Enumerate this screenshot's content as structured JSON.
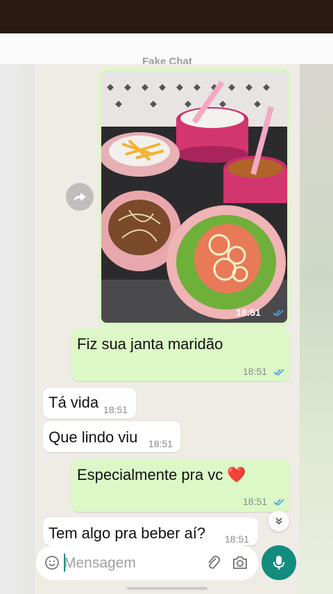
{
  "chat_title": "Fake Chat",
  "photo_message": {
    "time": "18:51"
  },
  "messages": [
    {
      "direction": "out",
      "text": "Fiz sua janta maridão",
      "time": "18:51",
      "ticks": "read"
    },
    {
      "direction": "in",
      "text": "Tá vida",
      "time": "18:51"
    },
    {
      "direction": "in",
      "text": "Que lindo viu",
      "time": "18:51"
    },
    {
      "direction": "out",
      "text": "Especialmente pra vc ❤️",
      "time": "18:51",
      "ticks": "read"
    },
    {
      "direction": "in",
      "text": "Tem algo pra beber aí?",
      "time": "18:51"
    }
  ],
  "input": {
    "placeholder": "Mensagem"
  },
  "icons": [
    "forward-icon",
    "chevron-double-down-icon",
    "emoji-icon",
    "attach-icon",
    "camera-icon",
    "mic-icon",
    "double-check-icon"
  ],
  "colors": {
    "outgoing_bubble": "#dcf8c6",
    "incoming_bubble": "#ffffff",
    "chat_background": "#efebe5",
    "accent": "#128c7e",
    "read_ticks": "#4fa3e0"
  }
}
